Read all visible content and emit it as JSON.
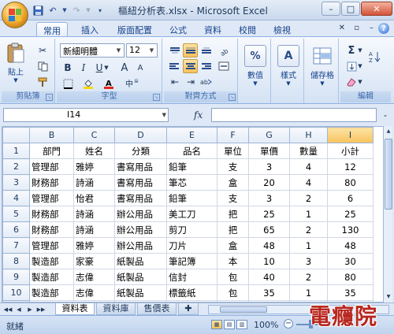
{
  "window": {
    "title": "樞紐分析表.xlsx - Microsoft Excel",
    "minimize": "–",
    "maximize": "□",
    "close": "✕"
  },
  "ribbon_tabs": [
    "常用",
    "插入",
    "版面配置",
    "公式",
    "資料",
    "校閱",
    "檢視"
  ],
  "ribbon": {
    "clipboard": {
      "paste": "貼上",
      "label": "剪貼簿"
    },
    "font": {
      "name": "新細明體",
      "size": "12",
      "label": "字型",
      "bold": "B",
      "italic": "I",
      "underline": "U",
      "grow": "A",
      "shrink": "A"
    },
    "alignment": {
      "label": "對齊方式"
    },
    "number": {
      "button": "數值",
      "icon": "%"
    },
    "styles": {
      "button": "樣式"
    },
    "cells": {
      "button": "儲存格"
    },
    "editing": {
      "label": "編輯"
    }
  },
  "formula_bar": {
    "name_box": "I14",
    "fx": "fx",
    "content": ""
  },
  "sheet": {
    "columns": [
      "B",
      "C",
      "D",
      "E",
      "F",
      "G",
      "H",
      "I"
    ],
    "selected_column": "I",
    "rows": [
      {
        "num": "1",
        "cells": [
          "部門",
          "姓名",
          "分類",
          "品名",
          "單位",
          "單價",
          "數量",
          "小計"
        ]
      },
      {
        "num": "2",
        "cells": [
          "管理部",
          "雅婷",
          "書寫用品",
          "鉛筆",
          "支",
          "3",
          "4",
          "12"
        ]
      },
      {
        "num": "3",
        "cells": [
          "財務部",
          "詩涵",
          "書寫用品",
          "筆芯",
          "盒",
          "20",
          "4",
          "80"
        ]
      },
      {
        "num": "4",
        "cells": [
          "管理部",
          "怡君",
          "書寫用品",
          "鉛筆",
          "支",
          "3",
          "2",
          "6"
        ]
      },
      {
        "num": "5",
        "cells": [
          "財務部",
          "詩涵",
          "辦公用品",
          "美工刀",
          "把",
          "25",
          "1",
          "25"
        ]
      },
      {
        "num": "6",
        "cells": [
          "財務部",
          "詩涵",
          "辦公用品",
          "剪刀",
          "把",
          "65",
          "2",
          "130"
        ]
      },
      {
        "num": "7",
        "cells": [
          "管理部",
          "雅婷",
          "辦公用品",
          "刀片",
          "盒",
          "48",
          "1",
          "48"
        ]
      },
      {
        "num": "8",
        "cells": [
          "製造部",
          "家豪",
          "紙製品",
          "筆記簿",
          "本",
          "10",
          "3",
          "30"
        ]
      },
      {
        "num": "9",
        "cells": [
          "製造部",
          "志偉",
          "紙製品",
          "信封",
          "包",
          "40",
          "2",
          "80"
        ]
      },
      {
        "num": "10",
        "cells": [
          "製造部",
          "志偉",
          "紙製品",
          "標籤紙",
          "包",
          "35",
          "1",
          "35"
        ]
      },
      {
        "num": "11",
        "cells": [
          "",
          "",
          "",
          "",
          "",
          "",
          "",
          ""
        ]
      }
    ]
  },
  "sheet_tabs": [
    "資料表",
    "資料庫",
    "售價表"
  ],
  "active_sheet": "資料表",
  "status": {
    "text": "就緒",
    "zoom": "100%"
  },
  "watermark": "電癮院",
  "colors": {
    "selected_header": "#f7c35d",
    "ribbon_text": "#15428b",
    "watermark": "#b8271f"
  }
}
